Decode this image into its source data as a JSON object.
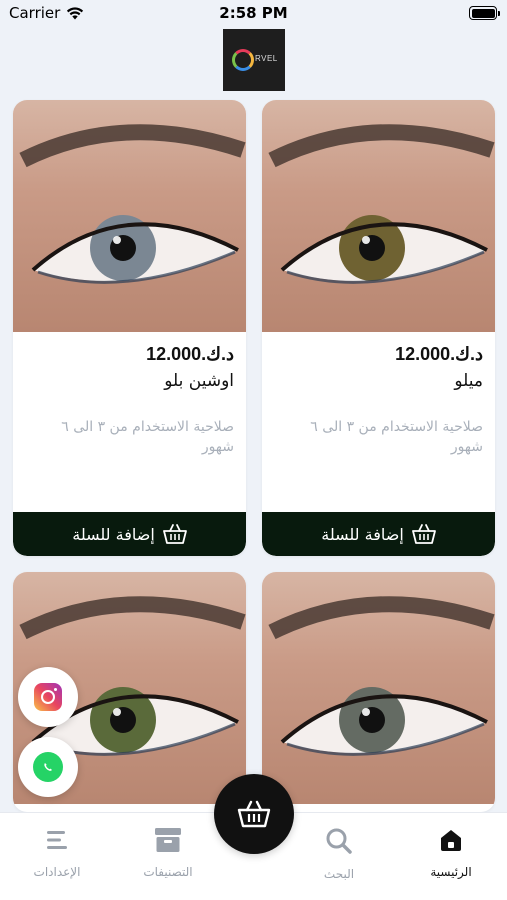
{
  "status_bar": {
    "carrier": "Carrier",
    "time": "2:58 PM"
  },
  "logo": {
    "text": "RVEL"
  },
  "products": [
    {
      "price": "د.ك.12.000",
      "name": "ميلو",
      "desc": "صلاحية الاستخدام من ٣ الى ٦ شهور",
      "add_label": "إضافة للسلة",
      "iris_color": "#6f6232"
    },
    {
      "price": "د.ك.12.000",
      "name": "اوشين بلو",
      "desc": "صلاحية الاستخدام من ٣ الى ٦ شهور",
      "add_label": "إضافة للسلة",
      "iris_color": "#7b8793"
    },
    {
      "iris_color": "#646b63"
    },
    {
      "iris_color": "#5a6a3a"
    }
  ],
  "tabs": [
    {
      "label": "الرئيسية",
      "icon": "home-icon",
      "active": true
    },
    {
      "label": "البحث",
      "icon": "search-icon",
      "active": false
    },
    {
      "label": "التصنيفات",
      "icon": "categories-icon",
      "active": false
    },
    {
      "label": "الإعدادات",
      "icon": "settings-menu-icon",
      "active": false
    }
  ],
  "colors": {
    "button_bg": "#081a0d",
    "background": "#eef2f8"
  }
}
